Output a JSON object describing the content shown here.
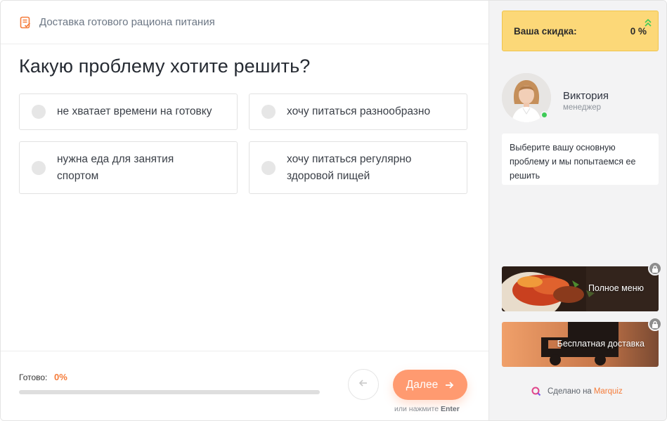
{
  "header": {
    "title": "Доставка готового рациона питания",
    "icon": "form-list-icon",
    "icon_color": "#f57c3a"
  },
  "question": "Какую проблему хотите решить?",
  "options": [
    {
      "label": "не хватает времени на готовку"
    },
    {
      "label": "хочу питаться разнообразно"
    },
    {
      "label": "нужна еда для занятия спортом"
    },
    {
      "label": "хочу питаться регулярно здоровой пищей"
    }
  ],
  "progress": {
    "label": "Готово:",
    "value_text": "0%",
    "value": 0
  },
  "nav": {
    "back_icon": "arrow-left-icon",
    "next_label": "Далее",
    "next_icon": "arrow-right-icon"
  },
  "hint": {
    "prefix": "или нажмите",
    "key": "Enter"
  },
  "sidebar": {
    "discount": {
      "label": "Ваша скидка:",
      "value": "0 %",
      "icon": "double-chevron-up-icon"
    },
    "manager": {
      "name": "Виктория",
      "role": "менеджер",
      "status": "online"
    },
    "message": "Выберите вашу основную проблему и мы попытаемся ее решить",
    "bonuses": [
      {
        "label": "Полное меню",
        "icon": "lock-icon"
      },
      {
        "label": "Бесплатная доставка",
        "icon": "lock-icon"
      }
    ],
    "made_by": {
      "prefix": "Сделано на",
      "brand": "Marquiz",
      "icon": "marquiz-logo-icon"
    }
  },
  "colors": {
    "accent": "#f57c3a",
    "next_button": "#ff9a70",
    "discount_bg": "#fcd878",
    "online": "#3ecb57"
  }
}
